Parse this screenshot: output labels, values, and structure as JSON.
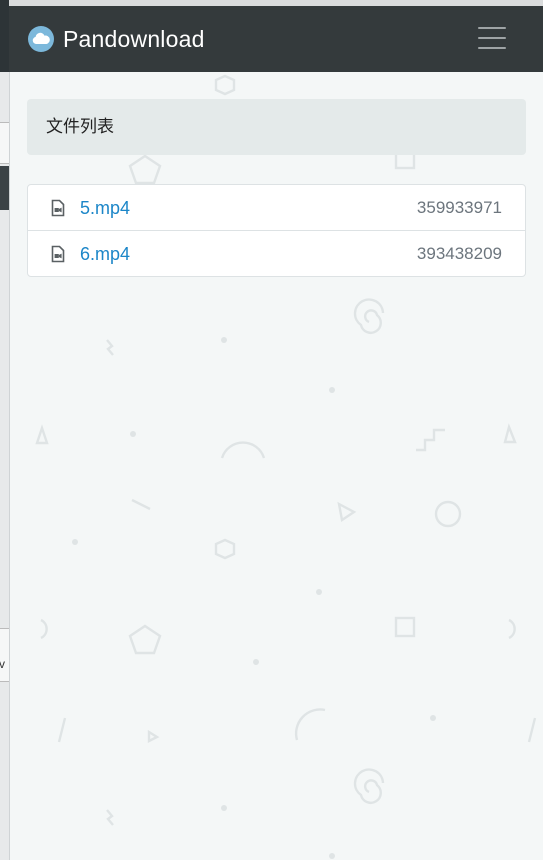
{
  "brand": {
    "name": "Pandownload",
    "icon": "cloud-icon",
    "accent": "#7cb8db"
  },
  "navbar": {
    "toggle_icon": "hamburger-menu-icon",
    "background": "#343a3c"
  },
  "breadcrumb": {
    "label": "文件列表"
  },
  "files": [
    {
      "name": "5.mp4",
      "size": "359933971",
      "icon": "video-file-icon"
    },
    {
      "name": "6.mp4",
      "size": "393438209",
      "icon": "video-file-icon"
    }
  ],
  "colors": {
    "link": "#1c86c8",
    "size_text": "#6c757d",
    "page_bg": "#f4f7f7"
  }
}
